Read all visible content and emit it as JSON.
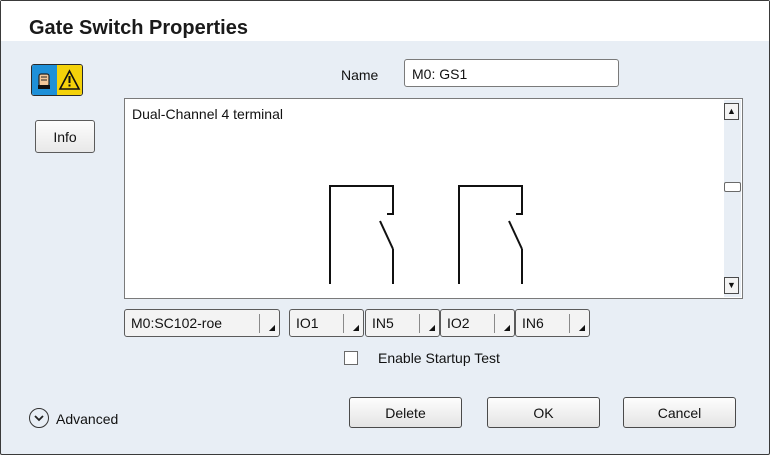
{
  "dialog": {
    "title": "Gate Switch Properties"
  },
  "mode_icon": {
    "left_icon": "hand-icon",
    "right_icon": "warning-triangle-icon",
    "left_color": "#1e90d8",
    "right_color": "#f4d20a"
  },
  "info_button": {
    "label": "Info"
  },
  "name": {
    "label": "Name",
    "value": "M0: GS1"
  },
  "description": {
    "text": "Dual-Channel 4 terminal"
  },
  "terminals": [
    {
      "value": "M0:SC102-roe"
    },
    {
      "value": "IO1"
    },
    {
      "value": "IN5"
    },
    {
      "value": "IO2"
    },
    {
      "value": "IN6"
    }
  ],
  "startup_test": {
    "label": "Enable Startup Test",
    "checked": false
  },
  "advanced": {
    "label": "Advanced"
  },
  "buttons": {
    "delete": "Delete",
    "ok": "OK",
    "cancel": "Cancel"
  }
}
